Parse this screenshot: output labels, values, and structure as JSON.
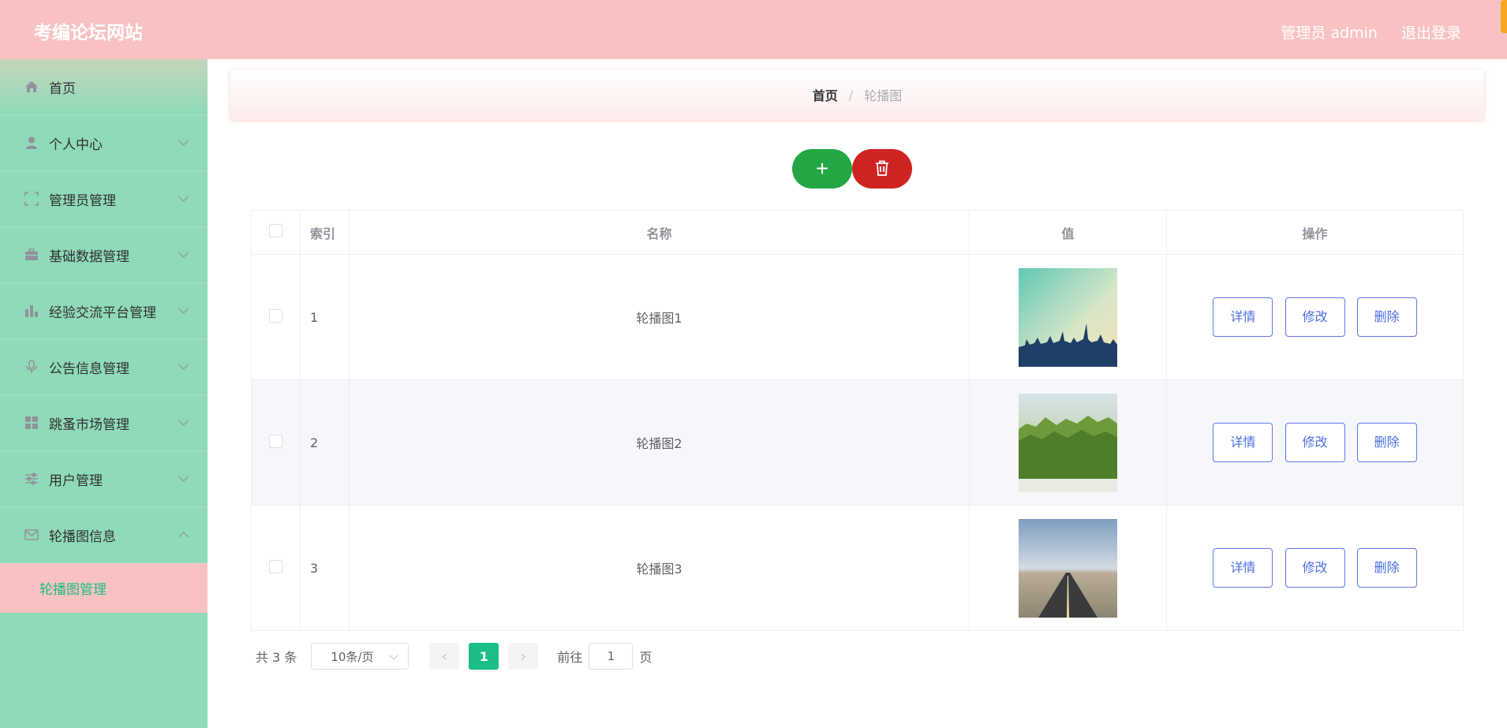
{
  "header": {
    "site_title": "考编论坛网站",
    "user_label": "管理员 admin",
    "logout_label": "退出登录"
  },
  "sidebar": {
    "items": [
      {
        "label": "首页",
        "icon": "home-icon"
      },
      {
        "label": "个人中心",
        "icon": "user-icon"
      },
      {
        "label": "管理员管理",
        "icon": "fullscreen-icon"
      },
      {
        "label": "基础数据管理",
        "icon": "briefcase-icon"
      },
      {
        "label": "经验交流平台管理",
        "icon": "bar-chart-icon"
      },
      {
        "label": "公告信息管理",
        "icon": "microphone-icon"
      },
      {
        "label": "跳蚤市场管理",
        "icon": "grid-icon"
      },
      {
        "label": "用户管理",
        "icon": "sliders-icon"
      },
      {
        "label": "轮播图信息",
        "icon": "mail-icon"
      }
    ],
    "submenu_active": "轮播图管理"
  },
  "breadcrumb": {
    "home": "首页",
    "separator": "/",
    "current": "轮播图"
  },
  "actions": {
    "add_symbol": "+"
  },
  "table": {
    "headers": {
      "index": "索引",
      "name": "名称",
      "value": "值",
      "operation": "操作"
    },
    "rows": [
      {
        "index": "1",
        "name": "轮播图1",
        "image": "city-skyline-image"
      },
      {
        "index": "2",
        "name": "轮播图2",
        "image": "forest-image"
      },
      {
        "index": "3",
        "name": "轮播图3",
        "image": "road-image"
      }
    ],
    "row_actions": {
      "detail": "详情",
      "edit": "修改",
      "delete": "删除"
    }
  },
  "pagination": {
    "total": "共 3 条",
    "page_size": "10条/页",
    "current_page": "1",
    "goto_prefix": "前往",
    "goto_value": "1",
    "goto_suffix": "页"
  },
  "colors": {
    "header_bg": "#f8c2c2",
    "sidebar_bg": "#8fdab7",
    "accent_green": "#1bbf85",
    "add_button": "#22a744",
    "delete_button": "#cf2323",
    "action_blue": "#4b6fe6"
  }
}
